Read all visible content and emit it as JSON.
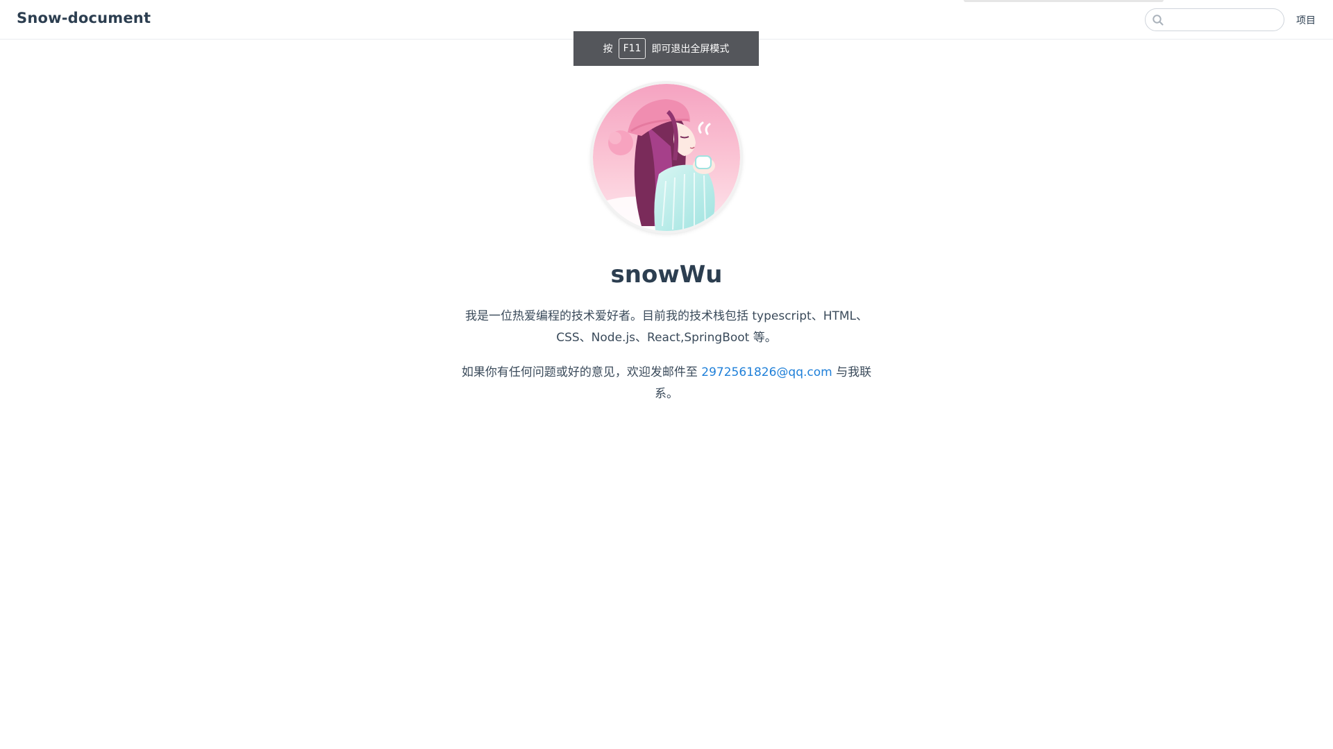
{
  "navbar": {
    "site_name": "Snow-document",
    "search": {
      "placeholder": "",
      "value": ""
    },
    "links": [
      {
        "label": "项目"
      }
    ]
  },
  "fullscreen_toast": {
    "prefix": "按",
    "key": "F11",
    "suffix": "即可退出全屏模式"
  },
  "hero": {
    "avatar_icon": "anime-girl-avatar",
    "title": "snowWu",
    "intro": "我是一位热爱编程的技术爱好者。目前我的技术栈包括 typescript、HTML、CSS、Node.js、React,SpringBoot 等。",
    "contact_prefix": "如果你有任何问题或好的意见，欢迎发邮件至 ",
    "contact_email": "2972561826@qq.com",
    "contact_suffix": " 与我联系。"
  },
  "colors": {
    "text": "#2c3e50",
    "link": "#1e7fd8",
    "toast_bg": "#54565b",
    "avatar_bg_top": "#f7a9c4",
    "avatar_bg_bottom": "#fde3ea"
  }
}
